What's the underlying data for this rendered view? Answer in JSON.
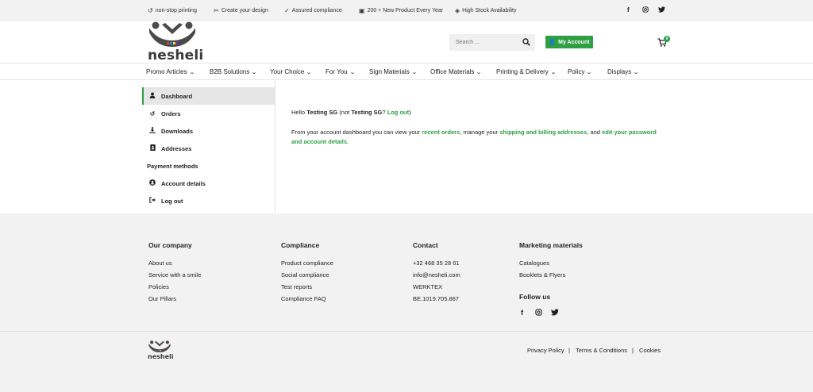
{
  "topbar": {
    "usps": [
      {
        "icon": "history-icon",
        "glyph": "↺",
        "label": "non-stop printing"
      },
      {
        "icon": "scissors-icon",
        "glyph": "✂",
        "label": "Create your design"
      },
      {
        "icon": "check-circle-icon",
        "glyph": "✓",
        "label": "Assured compliance"
      },
      {
        "icon": "bag-icon",
        "glyph": "▣",
        "label": "200 + New Product Every Year"
      },
      {
        "icon": "layers-icon",
        "glyph": "◈",
        "label": "High Stock Availability"
      }
    ],
    "social": [
      {
        "icon": "facebook-icon",
        "glyph": "f"
      },
      {
        "icon": "instagram-icon",
        "glyph": "◎"
      },
      {
        "icon": "twitter-icon",
        "glyph": "🐦"
      }
    ]
  },
  "header": {
    "logo_text": "nesheli",
    "search_placeholder": "Search ...",
    "account_label": "My Account",
    "cart_count": "0"
  },
  "nav": {
    "items": [
      "Promo Articles",
      "B2B Solutions",
      "Your Choice",
      "For You",
      "Sign Materials",
      "Office Materials",
      "Printing & Delivery",
      "Policy",
      "Displays"
    ]
  },
  "account_nav": {
    "items": [
      {
        "label": "Dashboard",
        "icon": "user-icon",
        "glyph": "●"
      },
      {
        "label": "Orders",
        "icon": "history-icon",
        "glyph": "↺"
      },
      {
        "label": "Downloads",
        "icon": "download-icon",
        "glyph": "⤓"
      },
      {
        "label": "Addresses",
        "icon": "address-book-icon",
        "glyph": "▤"
      },
      {
        "label": "Payment methods",
        "icon": "",
        "glyph": ""
      },
      {
        "label": "Account details",
        "icon": "user-circle-icon",
        "glyph": "◉"
      },
      {
        "label": "Log out",
        "icon": "sign-out-icon",
        "glyph": "⇥"
      }
    ]
  },
  "dashboard": {
    "hello": "Hello",
    "user": "Testing SG",
    "not_prefix": "(not",
    "not_user": "Testing SG",
    "logout_q": "?",
    "logout": "Log out",
    "close_paren": ")",
    "p_start": "From your account dashboard you can view your",
    "recent_orders": "recent orders",
    "p_mid": ", manage your",
    "addresses": "shipping and billing addresses",
    "p_and": ", and",
    "edit": "edit your password and account details",
    "p_end": "."
  },
  "footer": {
    "columns": [
      {
        "heading": "Our company",
        "links": [
          "About us",
          "Service with a smile",
          "Policies",
          "Our Pillars"
        ]
      },
      {
        "heading": "Compliance",
        "links": [
          "Product compliance",
          "Social compliance",
          "Test reports",
          "Compliance FAQ"
        ]
      },
      {
        "heading": "Contact",
        "links": [
          "+32 468 35 28 61",
          "info@nesheli.com",
          "WERKTEX",
          "BE.1019.705.867"
        ]
      },
      {
        "heading": "Marketing materials",
        "links": [
          "Catalogues",
          "Booklets & Flyers"
        ]
      }
    ],
    "follow": "Follow us",
    "logo_text": "nesheli",
    "legal": [
      "Privacy Policy",
      "|",
      "Terms & Conditions",
      "|",
      "Cookies"
    ]
  },
  "colors": {
    "accent": "#2ea043",
    "footer_bg": "#f2f2f2",
    "topbar_bg": "#f2f2f2"
  }
}
